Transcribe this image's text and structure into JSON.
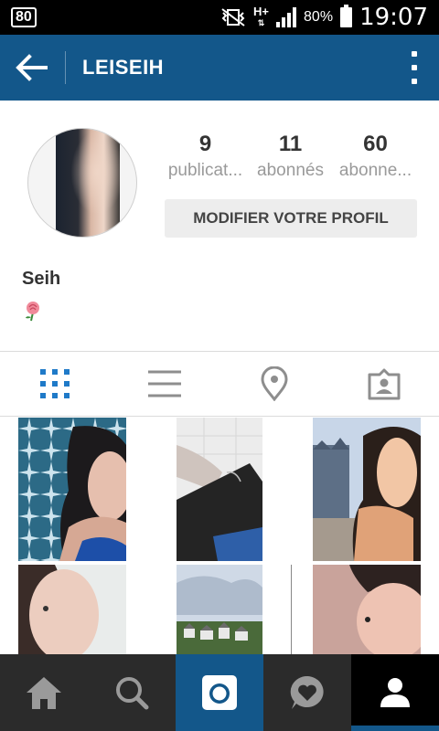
{
  "status_bar": {
    "left_badge": "80",
    "network": "H+",
    "battery_percent": "80%",
    "time": "19:07"
  },
  "app_bar": {
    "title": "LEISEIH",
    "back_icon": "arrow-left-icon",
    "menu_icon": "more-vert-icon",
    "color": "#13578a"
  },
  "profile": {
    "stats": [
      {
        "value": "9",
        "label": "publicat..."
      },
      {
        "value": "11",
        "label": "abonnés"
      },
      {
        "value": "60",
        "label": "abonne..."
      }
    ],
    "edit_button": "MODIFIER VOTRE PROFIL",
    "name": "Seih",
    "bio_icon": "rose-icon"
  },
  "tabs": [
    {
      "icon": "grid-icon",
      "active": true
    },
    {
      "icon": "list-icon",
      "active": false
    },
    {
      "icon": "location-pin-icon",
      "active": false
    },
    {
      "icon": "tagged-person-icon",
      "active": false
    }
  ],
  "posts": [
    {
      "subject": "selfie-blue-pattern"
    },
    {
      "subject": "hand-with-black-box"
    },
    {
      "subject": "selfie-street"
    },
    {
      "subject": "selfie-white-wall"
    },
    {
      "subject": "sky-rooftops"
    },
    {
      "subject": "selfie-close-up"
    }
  ],
  "bottom_nav": [
    {
      "icon": "home-icon"
    },
    {
      "icon": "search-icon"
    },
    {
      "icon": "camera-icon"
    },
    {
      "icon": "activity-heart-icon"
    },
    {
      "icon": "profile-icon",
      "active": true
    }
  ]
}
